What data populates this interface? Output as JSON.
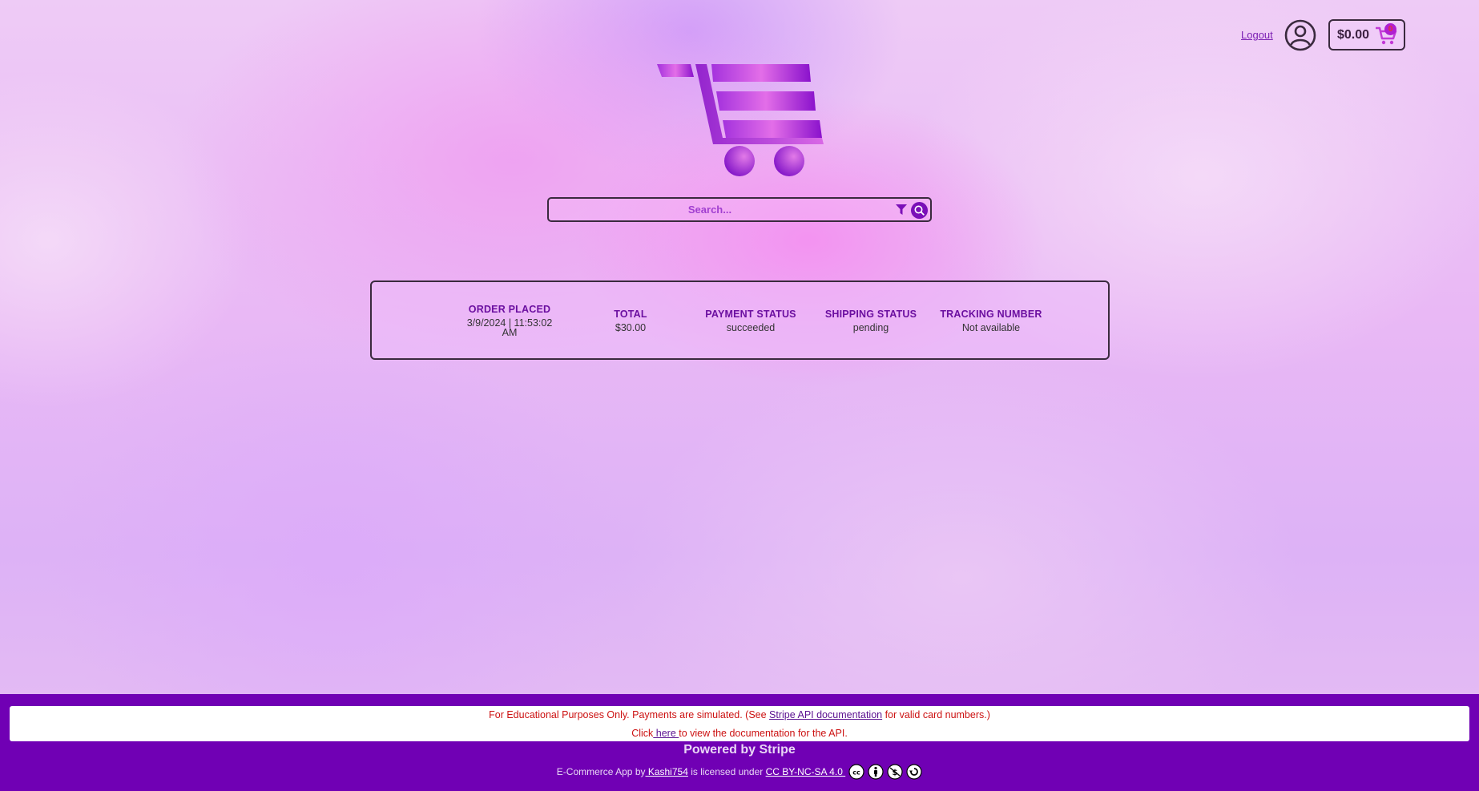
{
  "header": {
    "logout_label": "Logout",
    "cart_total": "$0.00",
    "cart_count": "0"
  },
  "search": {
    "placeholder": "Search..."
  },
  "order": {
    "placed_label": "ORDER PLACED",
    "placed_value": "3/9/2024 | 11:53:02 AM",
    "total_label": "TOTAL",
    "total_value": "$30.00",
    "payment_label": "PAYMENT STATUS",
    "payment_value": "succeeded",
    "shipping_label": "SHIPPING STATUS",
    "shipping_value": "pending",
    "tracking_label": "TRACKING NUMBER",
    "tracking_value": "Not available"
  },
  "footer": {
    "notice_prefix": "For Educational Purposes Only. Payments are simulated. (See ",
    "notice_link": "Stripe API documentation",
    "notice_suffix": " for valid card numbers.)",
    "click_prefix": "Click",
    "click_link": " here ",
    "click_suffix": "to view the documentation for the API.",
    "powered": "Powered by Stripe",
    "credit_prefix": "E-Commerce App by",
    "credit_author": " Kashi754",
    "credit_mid": " is licensed under ",
    "credit_license": "CC BY-NC-SA 4.0 ",
    "license_icons": [
      "cc-icon",
      "by-icon",
      "nc-icon",
      "sa-icon"
    ]
  },
  "colors": {
    "brand_purple": "#7000b4",
    "heading_purple": "#6b0fa0",
    "notice_red": "#cc1111"
  }
}
